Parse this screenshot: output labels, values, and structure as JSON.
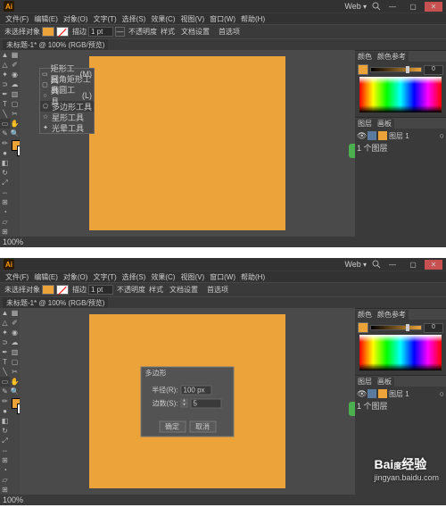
{
  "app_name": "Ai",
  "workspace_dropdown": "Web",
  "menu": [
    "文件(F)",
    "编辑(E)",
    "对象(O)",
    "文字(T)",
    "选择(S)",
    "效果(C)",
    "视图(V)",
    "窗口(W)",
    "帮助(H)"
  ],
  "control_bar": {
    "label_stroke": "描边",
    "stroke_value": "1 pt",
    "opacity_label": "不透明度",
    "style_label": "样式",
    "doc_setup": "文档设置",
    "preferences": "首选项"
  },
  "document": {
    "tab_label": "未标题-1* @ 100% (RGB/预览)",
    "no_selection": "未选择对象"
  },
  "tool_flyout": {
    "items": [
      {
        "icon": "▭",
        "label": "矩形工具",
        "shortcut": "(M)"
      },
      {
        "icon": "▢",
        "label": "圆角矩形工具",
        "shortcut": ""
      },
      {
        "icon": "○",
        "label": "椭圆工具",
        "shortcut": "(L)"
      },
      {
        "icon": "⬠",
        "label": "多边形工具",
        "shortcut": ""
      },
      {
        "icon": "☆",
        "label": "星形工具",
        "shortcut": ""
      },
      {
        "icon": "✦",
        "label": "光晕工具",
        "shortcut": ""
      }
    ]
  },
  "color_panel": {
    "tab1": "颜色",
    "tab2": "颜色参考",
    "val": "0"
  },
  "layers_panel": {
    "tab1": "图层",
    "tab2": "画板",
    "layers": [
      {
        "name": "图层 1",
        "visible": true
      },
      {
        "name": "图层 1",
        "visible": true
      }
    ],
    "count_label": "1 个图层"
  },
  "dialog": {
    "title": "多边形",
    "radius_label": "半径(R):",
    "radius_value": "100 px",
    "sides_label": "边数(S):",
    "sides_value": "5",
    "ok": "确定",
    "cancel": "取消"
  },
  "status": {
    "zoom": "100%"
  }
}
